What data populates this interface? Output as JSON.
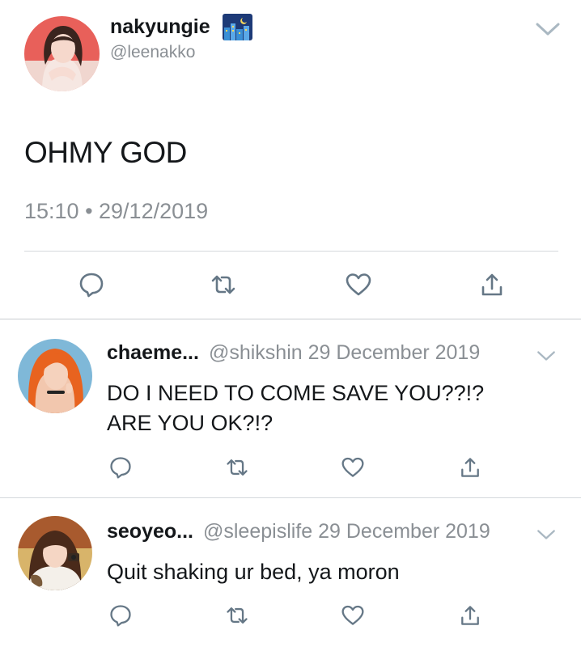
{
  "main_tweet": {
    "display_name": "nakyungie",
    "handle": "@leenakko",
    "text": "OHMY GOD",
    "timestamp": "15:10 • 29/12/2019",
    "emoji_icon": "night-city-emoji-icon"
  },
  "replies": [
    {
      "display_name": "chaeme...",
      "handle": "@shikshin",
      "date": "29 December 2019",
      "text_lines": [
        "DO I NEED TO COME SAVE YOU??!?",
        "ARE YOU OK?!?"
      ]
    },
    {
      "display_name": "seoyeo...",
      "handle": "@sleepislife",
      "date": "29 December 2019",
      "text_lines": [
        "Quit shaking ur bed, ya moron"
      ]
    }
  ],
  "actions": [
    "reply-icon",
    "retweet-icon",
    "like-icon",
    "share-icon"
  ],
  "colors": {
    "text_primary": "#14171a",
    "text_secondary": "#8a8f94",
    "icon_gray": "#657786",
    "divider": "#d5d9dc"
  }
}
